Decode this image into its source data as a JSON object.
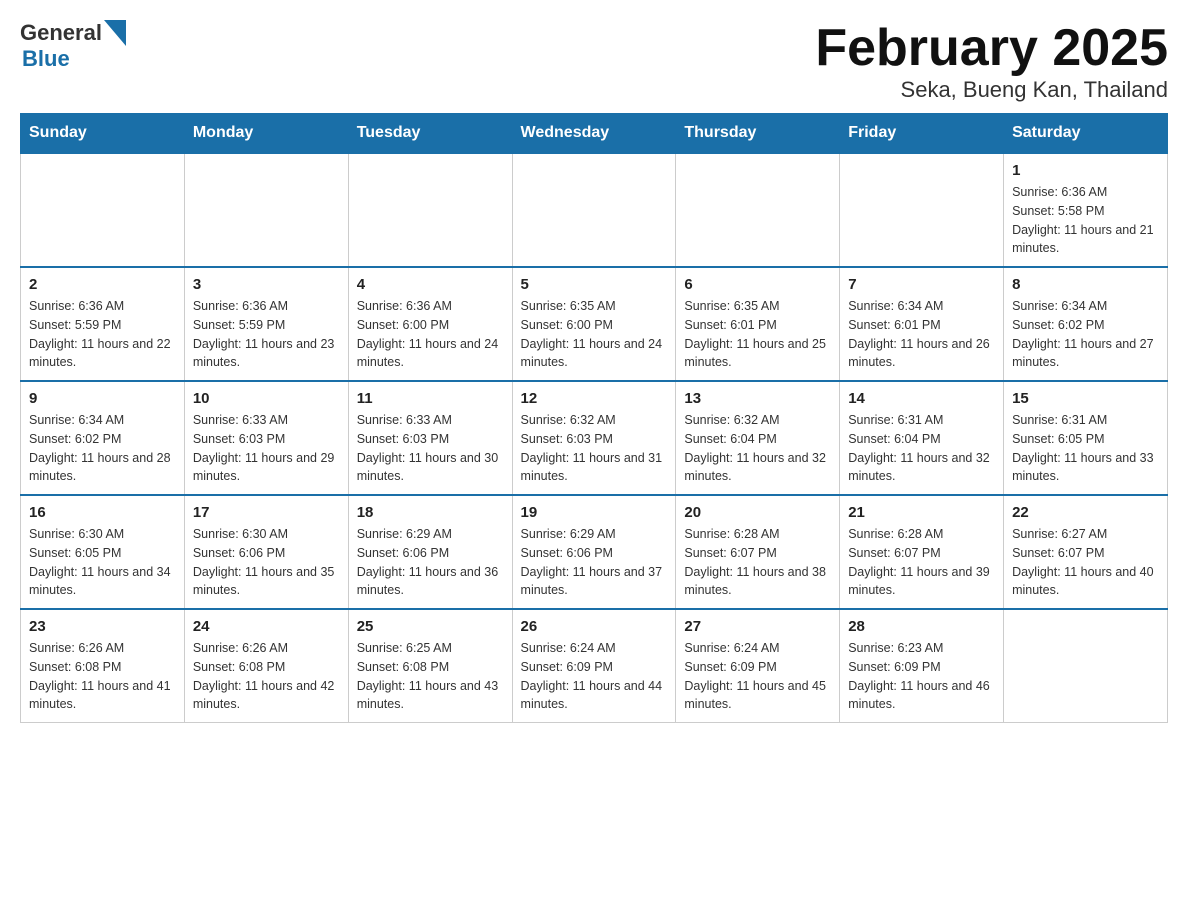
{
  "header": {
    "logo_general": "General",
    "logo_blue": "Blue",
    "title": "February 2025",
    "subtitle": "Seka, Bueng Kan, Thailand"
  },
  "days_of_week": [
    "Sunday",
    "Monday",
    "Tuesday",
    "Wednesday",
    "Thursday",
    "Friday",
    "Saturday"
  ],
  "weeks": [
    [
      {
        "day": "",
        "info": ""
      },
      {
        "day": "",
        "info": ""
      },
      {
        "day": "",
        "info": ""
      },
      {
        "day": "",
        "info": ""
      },
      {
        "day": "",
        "info": ""
      },
      {
        "day": "",
        "info": ""
      },
      {
        "day": "1",
        "info": "Sunrise: 6:36 AM\nSunset: 5:58 PM\nDaylight: 11 hours and 21 minutes."
      }
    ],
    [
      {
        "day": "2",
        "info": "Sunrise: 6:36 AM\nSunset: 5:59 PM\nDaylight: 11 hours and 22 minutes."
      },
      {
        "day": "3",
        "info": "Sunrise: 6:36 AM\nSunset: 5:59 PM\nDaylight: 11 hours and 23 minutes."
      },
      {
        "day": "4",
        "info": "Sunrise: 6:36 AM\nSunset: 6:00 PM\nDaylight: 11 hours and 24 minutes."
      },
      {
        "day": "5",
        "info": "Sunrise: 6:35 AM\nSunset: 6:00 PM\nDaylight: 11 hours and 24 minutes."
      },
      {
        "day": "6",
        "info": "Sunrise: 6:35 AM\nSunset: 6:01 PM\nDaylight: 11 hours and 25 minutes."
      },
      {
        "day": "7",
        "info": "Sunrise: 6:34 AM\nSunset: 6:01 PM\nDaylight: 11 hours and 26 minutes."
      },
      {
        "day": "8",
        "info": "Sunrise: 6:34 AM\nSunset: 6:02 PM\nDaylight: 11 hours and 27 minutes."
      }
    ],
    [
      {
        "day": "9",
        "info": "Sunrise: 6:34 AM\nSunset: 6:02 PM\nDaylight: 11 hours and 28 minutes."
      },
      {
        "day": "10",
        "info": "Sunrise: 6:33 AM\nSunset: 6:03 PM\nDaylight: 11 hours and 29 minutes."
      },
      {
        "day": "11",
        "info": "Sunrise: 6:33 AM\nSunset: 6:03 PM\nDaylight: 11 hours and 30 minutes."
      },
      {
        "day": "12",
        "info": "Sunrise: 6:32 AM\nSunset: 6:03 PM\nDaylight: 11 hours and 31 minutes."
      },
      {
        "day": "13",
        "info": "Sunrise: 6:32 AM\nSunset: 6:04 PM\nDaylight: 11 hours and 32 minutes."
      },
      {
        "day": "14",
        "info": "Sunrise: 6:31 AM\nSunset: 6:04 PM\nDaylight: 11 hours and 32 minutes."
      },
      {
        "day": "15",
        "info": "Sunrise: 6:31 AM\nSunset: 6:05 PM\nDaylight: 11 hours and 33 minutes."
      }
    ],
    [
      {
        "day": "16",
        "info": "Sunrise: 6:30 AM\nSunset: 6:05 PM\nDaylight: 11 hours and 34 minutes."
      },
      {
        "day": "17",
        "info": "Sunrise: 6:30 AM\nSunset: 6:06 PM\nDaylight: 11 hours and 35 minutes."
      },
      {
        "day": "18",
        "info": "Sunrise: 6:29 AM\nSunset: 6:06 PM\nDaylight: 11 hours and 36 minutes."
      },
      {
        "day": "19",
        "info": "Sunrise: 6:29 AM\nSunset: 6:06 PM\nDaylight: 11 hours and 37 minutes."
      },
      {
        "day": "20",
        "info": "Sunrise: 6:28 AM\nSunset: 6:07 PM\nDaylight: 11 hours and 38 minutes."
      },
      {
        "day": "21",
        "info": "Sunrise: 6:28 AM\nSunset: 6:07 PM\nDaylight: 11 hours and 39 minutes."
      },
      {
        "day": "22",
        "info": "Sunrise: 6:27 AM\nSunset: 6:07 PM\nDaylight: 11 hours and 40 minutes."
      }
    ],
    [
      {
        "day": "23",
        "info": "Sunrise: 6:26 AM\nSunset: 6:08 PM\nDaylight: 11 hours and 41 minutes."
      },
      {
        "day": "24",
        "info": "Sunrise: 6:26 AM\nSunset: 6:08 PM\nDaylight: 11 hours and 42 minutes."
      },
      {
        "day": "25",
        "info": "Sunrise: 6:25 AM\nSunset: 6:08 PM\nDaylight: 11 hours and 43 minutes."
      },
      {
        "day": "26",
        "info": "Sunrise: 6:24 AM\nSunset: 6:09 PM\nDaylight: 11 hours and 44 minutes."
      },
      {
        "day": "27",
        "info": "Sunrise: 6:24 AM\nSunset: 6:09 PM\nDaylight: 11 hours and 45 minutes."
      },
      {
        "day": "28",
        "info": "Sunrise: 6:23 AM\nSunset: 6:09 PM\nDaylight: 11 hours and 46 minutes."
      },
      {
        "day": "",
        "info": ""
      }
    ]
  ]
}
